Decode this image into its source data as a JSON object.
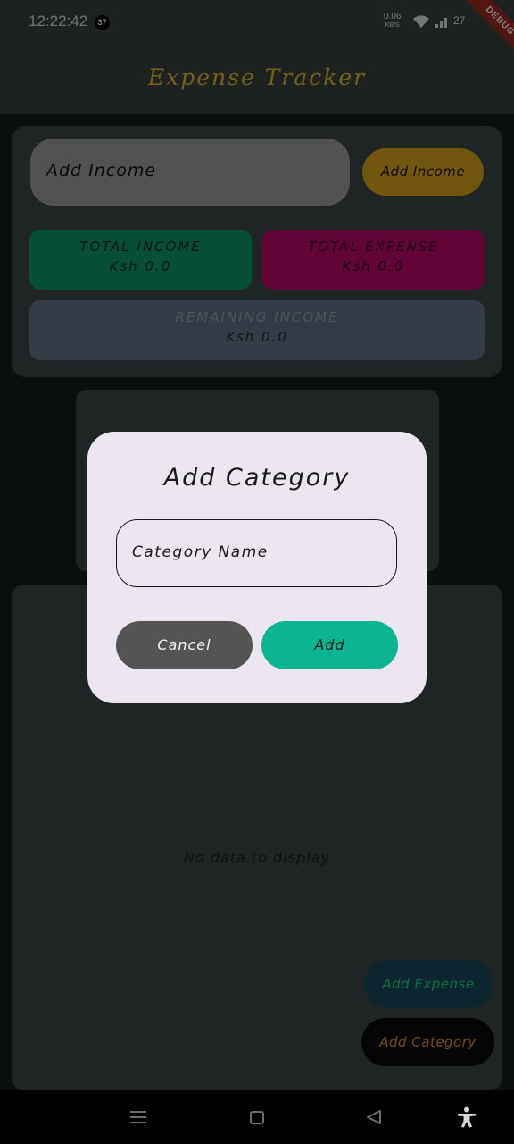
{
  "status_bar": {
    "time": "12:22:42",
    "notification_count": "37",
    "net_speed_value": "0.06",
    "net_speed_unit": "KB/S",
    "battery": "27"
  },
  "debug_banner": "DEBUG",
  "app_bar": {
    "title": "Expense Tracker"
  },
  "income_form": {
    "input_placeholder": "Add Income",
    "button_label": "Add Income"
  },
  "summary": {
    "total_income_label": "TOTAL INCOME",
    "total_income_value": "Ksh 0.0",
    "total_expense_label": "TOTAL EXPENSE",
    "total_expense_value": "Ksh 0.0",
    "remaining_label": "REMAINING INCOME",
    "remaining_value": "Ksh 0.0"
  },
  "list": {
    "empty_text": "No data to display"
  },
  "fabs": {
    "add_expense": "Add Expense",
    "add_category": "Add Category"
  },
  "dialog": {
    "title": "Add Category",
    "input_placeholder": "Category Name",
    "cancel_label": "Cancel",
    "add_label": "Add"
  },
  "nav_bar": {
    "icons": [
      "menu-icon",
      "home-icon",
      "back-icon",
      "accessibility-icon"
    ]
  },
  "colors": {
    "accent_gold": "#e2ad1b",
    "income_green": "#0a9e6f",
    "expense_pink": "#c4086a",
    "remaining_slate": "#66778c",
    "add_teal": "#0bb58f",
    "dialog_bg": "#ece6f1"
  }
}
